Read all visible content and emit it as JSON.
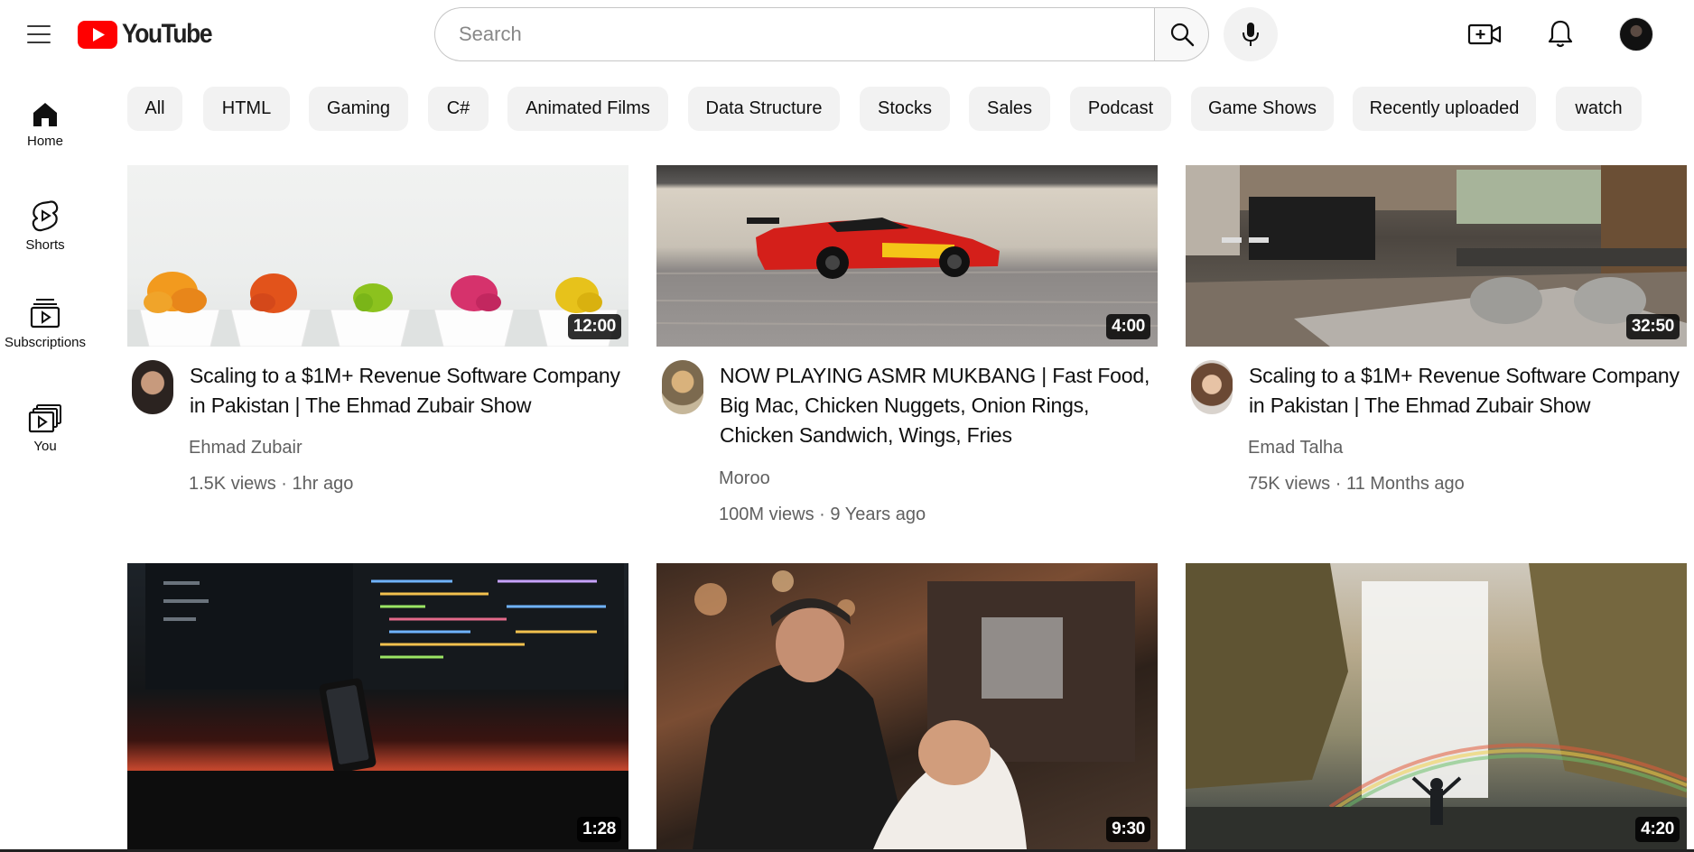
{
  "header": {
    "logo_text": "YouTube",
    "search_placeholder": "Search",
    "brand_color": "#FF0000"
  },
  "sidebar": {
    "items": [
      {
        "label": "Home",
        "icon": "home-icon"
      },
      {
        "label": "Shorts",
        "icon": "shorts-icon"
      },
      {
        "label": "Subscriptions",
        "icon": "subscriptions-icon"
      },
      {
        "label": "You",
        "icon": "you-library-icon"
      }
    ]
  },
  "chips": [
    "All",
    "HTML",
    "Gaming",
    "C#",
    "Animated Films",
    "Data Structure",
    "Stocks",
    "Sales",
    "Podcast",
    "Game Shows",
    "Recently uploaded",
    "watch"
  ],
  "videos": [
    {
      "title": "Scaling to a $1M+ Revenue Software Company in Pakistan | The Ehmad Zubair Show",
      "channel": "Ehmad Zubair",
      "views": "1.5K views",
      "age": "1hr ago",
      "duration": "12:00"
    },
    {
      "title": "NOW PLAYING ASMR MUKBANG | Fast Food, Big Mac, Chicken Nuggets, Onion Rings, Chicken Sandwich, Wings, Fries",
      "channel": "Moroo",
      "views": "100M views",
      "age": "9 Years ago",
      "duration": "4:00"
    },
    {
      "title": "Scaling to a $1M+ Revenue Software Company in Pakistan | The Ehmad Zubair Show",
      "channel": "Emad Talha",
      "views": "75K views",
      "age": "11 Months ago",
      "duration": "32:50"
    },
    {
      "duration": "1:28"
    },
    {
      "duration": "9:30"
    },
    {
      "duration": "4:20"
    }
  ],
  "separator": "·"
}
